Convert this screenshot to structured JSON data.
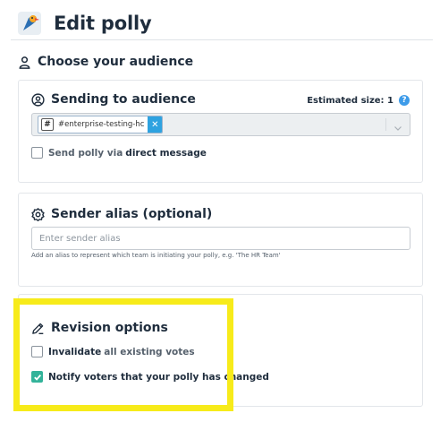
{
  "header": {
    "title": "Edit polly"
  },
  "audience_section": {
    "heading": "Choose your audience"
  },
  "sending": {
    "title": "Sending to audience",
    "estimated_size": "Estimated size: 1",
    "help": "?",
    "selected_channels": [
      "#enterprise-testing-hc"
    ],
    "direct_message_prefix": "Send polly via",
    "direct_message_bold": "direct message",
    "direct_message_checked": false
  },
  "alias": {
    "title": "Sender alias (optional)",
    "placeholder": "Enter sender alias",
    "value": "",
    "hint": "Add an alias to represent which team is initiating your polly, e.g. 'The HR Team'"
  },
  "revision": {
    "title": "Revision options",
    "invalidate_bold": "Invalidate",
    "invalidate_rest": "all existing votes",
    "invalidate_checked": false,
    "notify_label": "Notify voters that your polly has changed",
    "notify_checked": true
  },
  "colors": {
    "accent": "#2ea2e0",
    "checkbox_checked": "#33b39a",
    "highlight": "#f7eb1a",
    "title": "#1f2d3d"
  }
}
